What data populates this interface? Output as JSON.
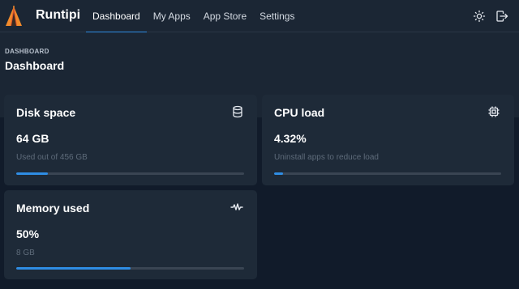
{
  "app": {
    "brand": "Runtipi",
    "nav": [
      {
        "label": "Dashboard",
        "active": true
      },
      {
        "label": "My Apps",
        "active": false
      },
      {
        "label": "App Store",
        "active": false
      },
      {
        "label": "Settings",
        "active": false
      }
    ],
    "header_icons": [
      "sun-icon",
      "logout-icon"
    ]
  },
  "page": {
    "pretitle": "DASHBOARD",
    "title": "Dashboard"
  },
  "cards": {
    "disk": {
      "title": "Disk space",
      "value": "64 GB",
      "subtitle": "Used out of 456 GB",
      "icon": "database-icon",
      "progress": 0.14
    },
    "cpu": {
      "title": "CPU load",
      "value": "4.32%",
      "subtitle": "Uninstall apps to reduce load",
      "icon": "cpu-icon",
      "progress": 0.04
    },
    "memory": {
      "title": "Memory used",
      "value": "50%",
      "subtitle": "8 GB",
      "icon": "activity-icon",
      "progress": 0.5
    }
  },
  "colors": {
    "accent": "#2f8de4",
    "background": "#111b2a",
    "surface": "#1e2a38"
  }
}
